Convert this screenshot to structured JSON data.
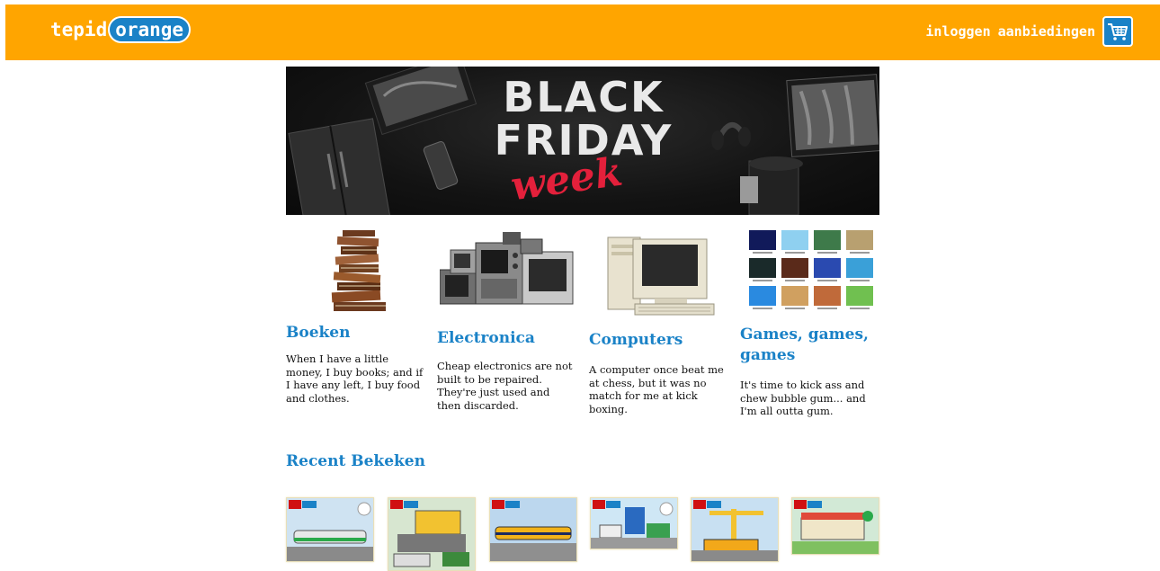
{
  "header": {
    "logo_prefix": "tepid",
    "logo_highlight": "orange",
    "login_link": "inloggen",
    "offers_link": "aanbiedingen",
    "cart_icon": "shopping-cart-icon",
    "bar_color": "#ffa500",
    "accent_color": "#1a82c7"
  },
  "banner": {
    "line1": "BLACK",
    "line2": "FRIDAY",
    "script": "week"
  },
  "categories": [
    {
      "title": "Boeken",
      "text": "When I have a little money, I buy books; and if I have any left, I buy food and clothes."
    },
    {
      "title": "Electronica",
      "text": "Cheap electronics are not built to be repaired. They're just used and then discarded."
    },
    {
      "title": "Computers",
      "text": "A computer once beat me at chess, but it was no match for me at kick boxing."
    },
    {
      "title": "Games, games, games",
      "text": "It's time to kick ass and chew bubble gum... and I'm all outta gum."
    }
  ],
  "recent": {
    "title": "Recent Bekeken",
    "products": [
      {
        "brand": "LEGO",
        "line": "CITY"
      },
      {
        "brand": "LEGO",
        "line": "CITY"
      },
      {
        "brand": "LEGO",
        "line": "CITY"
      },
      {
        "brand": "LEGO",
        "line": "CITY"
      },
      {
        "brand": "LEGO",
        "line": "CITY"
      },
      {
        "brand": "LEGO",
        "line": "CITY"
      }
    ]
  }
}
